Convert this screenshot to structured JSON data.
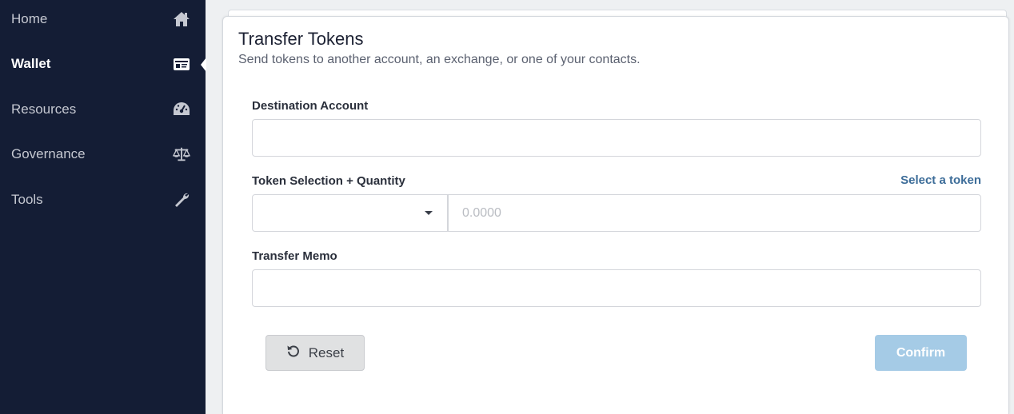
{
  "sidebar": {
    "items": [
      {
        "label": "Home",
        "icon": "home-icon"
      },
      {
        "label": "Wallet",
        "icon": "id-card-icon",
        "active": true
      },
      {
        "label": "Resources",
        "icon": "gauge-icon"
      },
      {
        "label": "Governance",
        "icon": "balance-scale-icon"
      },
      {
        "label": "Tools",
        "icon": "wrench-icon"
      }
    ]
  },
  "transfer": {
    "title": "Transfer Tokens",
    "subtitle": "Send tokens to another account, an exchange, or one of your contacts.",
    "destination_label": "Destination Account",
    "destination_value": "",
    "token_label": "Token Selection + Quantity",
    "select_token_link": "Select a token",
    "token_selected": "",
    "quantity_placeholder": "0.0000",
    "memo_label": "Transfer Memo",
    "memo_value": "",
    "reset_label": "Reset",
    "confirm_label": "Confirm"
  },
  "colors": {
    "sidebar_bg": "#141d35",
    "link": "#3d6d99",
    "confirm_bg": "#a5cbe6",
    "reset_bg": "#e0e1e2"
  }
}
